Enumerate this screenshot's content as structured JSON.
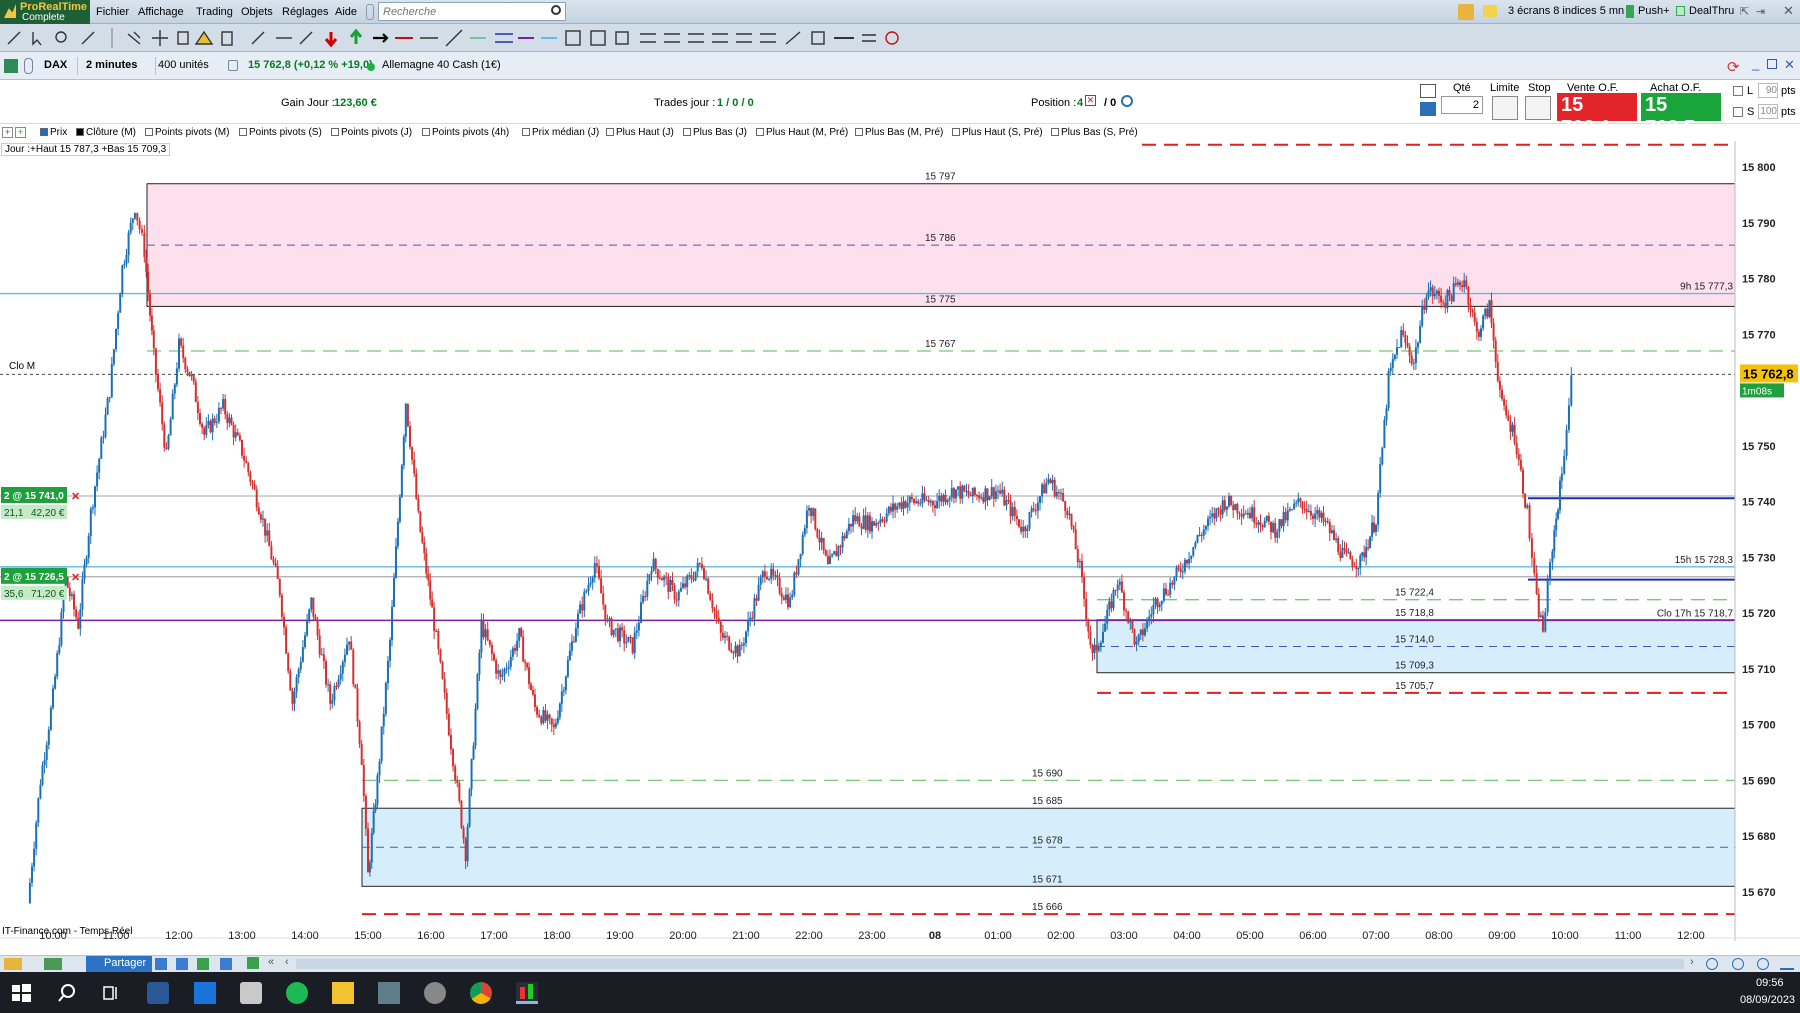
{
  "app": {
    "logo_line1": "ProRealTime",
    "logo_line2": "Complete"
  },
  "menu": [
    "Fichier",
    "Affichage",
    "Trading",
    "Objets",
    "Réglages",
    "Aide"
  ],
  "search": {
    "placeholder": "Recherche"
  },
  "topright": {
    "screens": "3 écrans 8 indices 5 mn",
    "push": "Push+",
    "dealthru": "DealThru"
  },
  "chartbar": {
    "instrument": "DAX",
    "timeframe": "2 minutes",
    "units": "400 unités",
    "quote": "15 762,8 (+0,12 % +19,0)",
    "name": "Allemagne 40 Cash (1€)"
  },
  "infobar": {
    "gain_label": "Gain Jour :",
    "gain_value": "123,60 €",
    "trades_label": "Trades jour :",
    "trades_value": "1 / 0 / 0",
    "position_label": "Position :",
    "position_value": "4",
    "position_rest": "/ 0",
    "qte_label": "Qté",
    "qte_value": "2",
    "limite_label": "Limite",
    "stop_label": "Stop",
    "vente_label": "Vente O.F.",
    "vente_value": "15 762,1",
    "achat_label": "Achat O.F.",
    "achat_value": "15 763,5",
    "l_label": "L",
    "l_value": "90",
    "s_label": "S",
    "s_value": "100",
    "pts": "pts",
    "colors": {
      "sell": "#e3242b",
      "buy": "#19a53a"
    }
  },
  "indicators": [
    "Prix",
    "Clôture (M)",
    "Points pivots (M)",
    "Points pivots (S)",
    "Points pivots (J)",
    "Points pivots (4h)",
    "Prix médian (J)",
    "Plus Haut (J)",
    "Plus Bas (J)",
    "Plus Haut (M, Pré)",
    "Plus Bas (M, Pré)",
    "Plus Haut (S, Pré)",
    "Plus Bas (S, Pré)"
  ],
  "chart_info": {
    "day_range": "Jour :+Haut 15 787,3 +Bas 15 709,3",
    "source": "IT-Finance.com - Temps Réel",
    "clo_m": "Clo M"
  },
  "chart_data": {
    "type": "candlestick",
    "ylim": [
      15664,
      15806
    ],
    "y_ticks": [
      "15 670",
      "15 680",
      "15 690",
      "15 700",
      "15 710",
      "15 720",
      "15 730",
      "15 740",
      "15 750",
      "15 760",
      "15 770",
      "15 780",
      "15 790",
      "15 800"
    ],
    "y_tick_values": [
      15670,
      15680,
      15690,
      15700,
      15710,
      15720,
      15730,
      15740,
      15750,
      15760,
      15770,
      15780,
      15790,
      15800
    ],
    "x_ticks": [
      "10:00",
      "11:00",
      "12:00",
      "13:00",
      "14:00",
      "15:00",
      "16:00",
      "17:00",
      "18:00",
      "19:00",
      "20:00",
      "21:00",
      "22:00",
      "23:00",
      "08",
      "01:00",
      "02:00",
      "03:00",
      "04:00",
      "05:00",
      "06:00",
      "07:00",
      "08:00",
      "09:00",
      "10:00",
      "11:00",
      "12:00"
    ],
    "price_path": [
      [
        9.6,
        15668
      ],
      [
        9.8,
        15690
      ],
      [
        10.0,
        15705
      ],
      [
        10.2,
        15726
      ],
      [
        10.4,
        15718
      ],
      [
        10.6,
        15738
      ],
      [
        10.9,
        15760
      ],
      [
        11.1,
        15782
      ],
      [
        11.3,
        15793
      ],
      [
        11.45,
        15785
      ],
      [
        11.6,
        15766
      ],
      [
        11.8,
        15748
      ],
      [
        12.0,
        15768
      ],
      [
        12.2,
        15762
      ],
      [
        12.4,
        15752
      ],
      [
        12.7,
        15757
      ],
      [
        13.0,
        15749
      ],
      [
        13.3,
        15738
      ],
      [
        13.6,
        15724
      ],
      [
        13.8,
        15704
      ],
      [
        14.1,
        15722
      ],
      [
        14.4,
        15704
      ],
      [
        14.7,
        15716
      ],
      [
        14.9,
        15694
      ],
      [
        15.0,
        15673
      ],
      [
        15.15,
        15690
      ],
      [
        15.35,
        15715
      ],
      [
        15.6,
        15758
      ],
      [
        15.8,
        15737
      ],
      [
        16.05,
        15718
      ],
      [
        16.35,
        15694
      ],
      [
        16.55,
        15677
      ],
      [
        16.8,
        15718
      ],
      [
        17.1,
        15708
      ],
      [
        17.4,
        15716
      ],
      [
        17.65,
        15703
      ],
      [
        17.95,
        15699
      ],
      [
        18.3,
        15718
      ],
      [
        18.6,
        15729
      ],
      [
        18.8,
        15718
      ],
      [
        19.2,
        15714
      ],
      [
        19.5,
        15729
      ],
      [
        19.9,
        15723
      ],
      [
        20.3,
        15729
      ],
      [
        20.6,
        15716
      ],
      [
        20.9,
        15713
      ],
      [
        21.3,
        15728
      ],
      [
        21.7,
        15722
      ],
      [
        22.0,
        15740
      ],
      [
        22.3,
        15728
      ],
      [
        22.7,
        15737
      ],
      [
        23.0,
        15736
      ],
      [
        23.5,
        15740
      ],
      [
        24.0,
        15740
      ],
      [
        24.3,
        15742
      ],
      [
        24.6,
        15741
      ],
      [
        25.0,
        15742
      ],
      [
        25.4,
        15735
      ],
      [
        25.8,
        15744
      ],
      [
        26.1,
        15739
      ],
      [
        26.3,
        15728
      ],
      [
        26.5,
        15712
      ],
      [
        26.7,
        15718
      ],
      [
        26.9,
        15726
      ],
      [
        27.2,
        15714
      ],
      [
        27.5,
        15722
      ],
      [
        27.8,
        15726
      ],
      [
        28.2,
        15734
      ],
      [
        28.6,
        15740
      ],
      [
        29.0,
        15738
      ],
      [
        29.4,
        15735
      ],
      [
        29.8,
        15740
      ],
      [
        30.2,
        15736
      ],
      [
        30.5,
        15730
      ],
      [
        30.75,
        15729
      ],
      [
        31.0,
        15737
      ],
      [
        31.2,
        15762
      ],
      [
        31.4,
        15770
      ],
      [
        31.6,
        15765
      ],
      [
        31.8,
        15778
      ],
      [
        32.1,
        15776
      ],
      [
        32.4,
        15780
      ],
      [
        32.6,
        15770
      ],
      [
        32.8,
        15775
      ],
      [
        33.0,
        15757
      ],
      [
        33.2,
        15752
      ],
      [
        33.4,
        15738
      ],
      [
        33.55,
        15722
      ],
      [
        33.65,
        15717
      ],
      [
        33.8,
        15732
      ],
      [
        33.95,
        15745
      ],
      [
        34.1,
        15762
      ]
    ],
    "levels": [
      {
        "value": 15797,
        "label": "15 797"
      },
      {
        "value": 15786,
        "label": "15 786"
      },
      {
        "value": 15775,
        "label": "15 775"
      },
      {
        "value": 15767,
        "label": "15 767"
      },
      {
        "value": 15722.4,
        "label": "15 722,4"
      },
      {
        "value": 15718.8,
        "label": "15 718,8"
      },
      {
        "value": 15714.0,
        "label": "15 714,0"
      },
      {
        "value": 15709.3,
        "label": "15 709,3"
      },
      {
        "value": 15705.7,
        "label": "15 705,7"
      },
      {
        "value": 15690,
        "label": "15 690"
      },
      {
        "value": 15685,
        "label": "15 685"
      },
      {
        "value": 15678,
        "label": "15 678"
      },
      {
        "value": 15671,
        "label": "15 671"
      },
      {
        "value": 15666,
        "label": "15 666"
      }
    ],
    "right_labels": [
      {
        "value": 15777.3,
        "label": "9h 15 777,3"
      },
      {
        "value": 15728.3,
        "label": "15h 15 728,3"
      },
      {
        "value": 15718.7,
        "label": "Clo 17h 15 718,7"
      }
    ],
    "orders": [
      {
        "value": 15741.0,
        "label": "2 @ 15 741,0",
        "pts": "21,1",
        "pnl": "42,20 €"
      },
      {
        "value": 15726.5,
        "label": "2 @ 15 726,5",
        "pts": "35,6",
        "pnl": "71,20 €"
      }
    ],
    "last_price": {
      "value": 15762.8,
      "label": "15 762,8",
      "timer": "1m08s"
    },
    "colors": {
      "up": "#1a6fb5",
      "down": "#d43030",
      "pink_zone": "#fde0ec",
      "blue_zone": "#d6eefb",
      "red_dash": "#e02020",
      "green_dash": "#7cc47c",
      "blue_dash": "#4b56c9",
      "purple": "#7a1fa2",
      "light_blue": "#5fbce8"
    }
  },
  "statusbar": {
    "share": "Partager"
  },
  "taskbar": {
    "time": "09:56",
    "date": "08/09/2023"
  }
}
